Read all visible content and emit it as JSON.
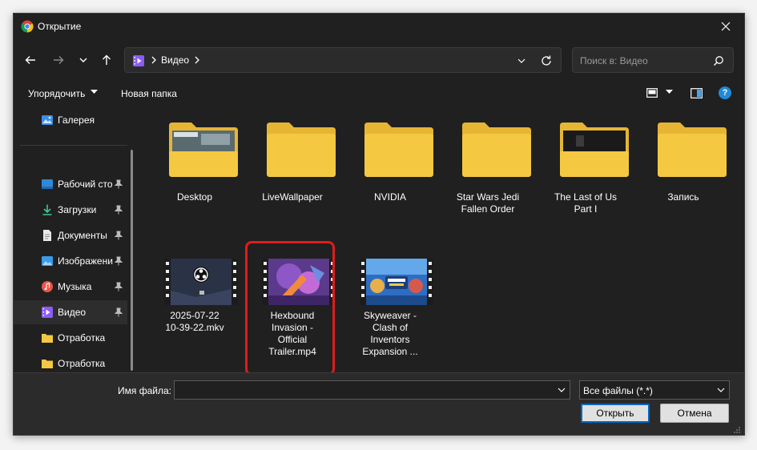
{
  "window": {
    "title": "Открытие"
  },
  "nav": {
    "path_segment": "Видео"
  },
  "search": {
    "placeholder": "Поиск в: Видео"
  },
  "toolbar": {
    "organize_label": "Упорядочить",
    "new_folder_label": "Новая папка",
    "help_label": "?"
  },
  "sidebar": {
    "items": [
      {
        "label": "Галерея",
        "icon": "gallery-icon"
      },
      {
        "label": "Рабочий сто",
        "icon": "desktop-icon",
        "pinned": true
      },
      {
        "label": "Загрузки",
        "icon": "download-icon",
        "pinned": true
      },
      {
        "label": "Документы",
        "icon": "documents-icon",
        "pinned": true
      },
      {
        "label": "Изображени",
        "icon": "pictures-icon",
        "pinned": true
      },
      {
        "label": "Музыка",
        "icon": "music-icon",
        "pinned": true
      },
      {
        "label": "Видео",
        "icon": "videos-icon",
        "pinned": true,
        "selected": true
      },
      {
        "label": "Отработка",
        "icon": "folder-icon"
      },
      {
        "label": "Отработка",
        "icon": "folder-icon"
      }
    ]
  },
  "files": {
    "folders": [
      {
        "name": "Desktop"
      },
      {
        "name": "LiveWallpaper"
      },
      {
        "name": "NVIDIA"
      },
      {
        "name_line1": "Star Wars Jedi",
        "name_line2": "Fallen Order"
      },
      {
        "name_line1": "The Last of Us",
        "name_line2": "Part I"
      },
      {
        "name": "Запись"
      }
    ],
    "videos": [
      {
        "name_line1": "2025-07-22",
        "name_line2": "10-39-22.mkv"
      },
      {
        "name_line1": "Hexbound",
        "name_line2": "Invasion -",
        "name_line3": "Official",
        "name_line4": "Trailer.mp4"
      },
      {
        "name_line1": "Skyweaver -",
        "name_line2": "Clash of",
        "name_line3": "Inventors",
        "name_line4": "Expansion ..."
      }
    ]
  },
  "footer": {
    "filename_label": "Имя файла:",
    "filename_value": "",
    "filetype_value": "Все файлы (*.*)",
    "open_label": "Открыть",
    "cancel_label": "Отмена"
  },
  "colors": {
    "accent": "#0067c0",
    "highlight": "#e01c1c",
    "folder": "#f5c842"
  }
}
